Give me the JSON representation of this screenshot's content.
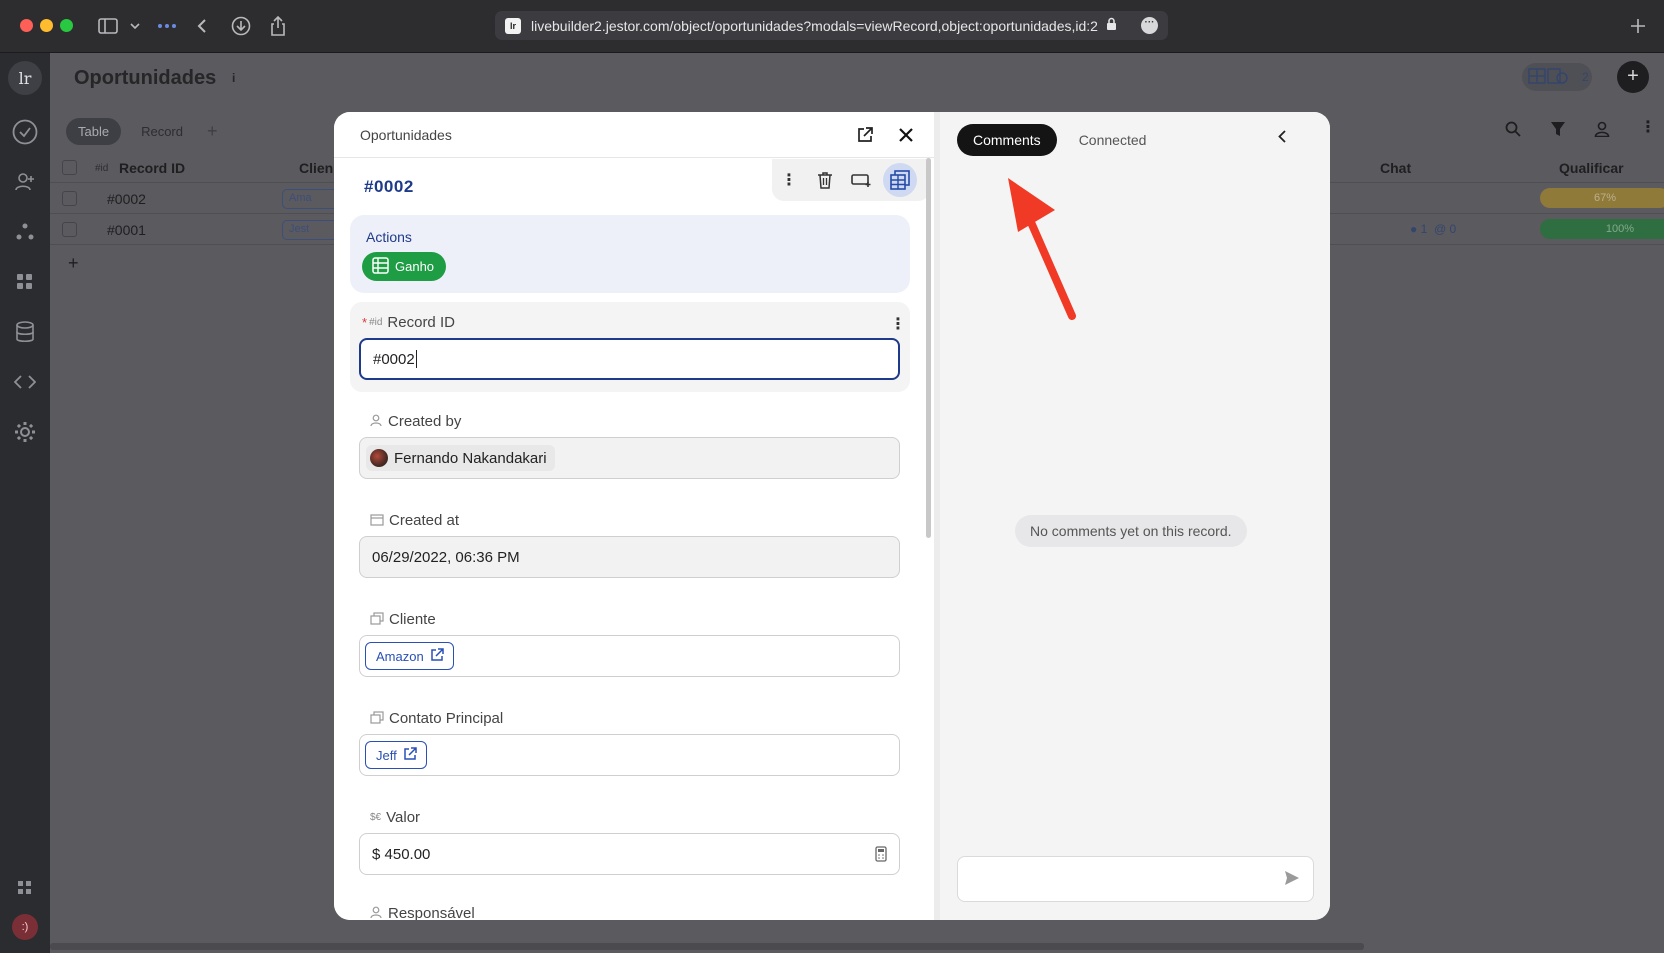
{
  "browser": {
    "url": "livebuilder2.jestor.com/object/oportunidades?modals=viewRecord,object:oportunidades,id:2",
    "favicon_text": "lr"
  },
  "background": {
    "title": "Oportunidades",
    "info_glyph": "i",
    "tabs": [
      {
        "label": "Table",
        "active": true
      },
      {
        "label": "Record",
        "active": false
      }
    ],
    "views_count": "2",
    "columns": {
      "record_id_type": "#id",
      "record_id": "Record ID",
      "cliente": "Clien",
      "chat": "Chat",
      "qualificar": "Qualificar"
    },
    "rows": [
      {
        "id": "#0002",
        "cliente": "Ama",
        "progress": "67%",
        "progress_color": "#c59a2d"
      },
      {
        "id": "#0001",
        "cliente": "Jest",
        "progress": "100%",
        "progress_color": "#2e8b4a",
        "chat_count": "1",
        "mention_count": "0"
      }
    ],
    "add_row": "+",
    "user_initial": ":)"
  },
  "record": {
    "header_title": "Oportunidades",
    "record_id": "#0002",
    "actions": {
      "label": "Actions",
      "button": "Ganho"
    },
    "fields": {
      "record_id": {
        "type": "#id",
        "label": "Record ID",
        "value": "#0002"
      },
      "created_by": {
        "label": "Created by",
        "value": "Fernando Nakandakari"
      },
      "created_at": {
        "label": "Created at",
        "value": "06/29/2022, 06:36 PM"
      },
      "cliente": {
        "label": "Cliente",
        "value": "Amazon"
      },
      "contato": {
        "label": "Contato Principal",
        "value": "Jeff"
      },
      "valor": {
        "type": "$€",
        "label": "Valor",
        "value": "$ 450.00"
      },
      "responsavel": {
        "label": "Responsável"
      }
    }
  },
  "comments": {
    "tabs": [
      {
        "label": "Comments",
        "active": true
      },
      {
        "label": "Connected",
        "active": false
      }
    ],
    "empty_message": "No comments yet on this record.",
    "input_placeholder": ""
  },
  "colors": {
    "accent": "#1e3a8a",
    "success": "#1f9d45",
    "annotation_arrow": "#f03a26"
  }
}
